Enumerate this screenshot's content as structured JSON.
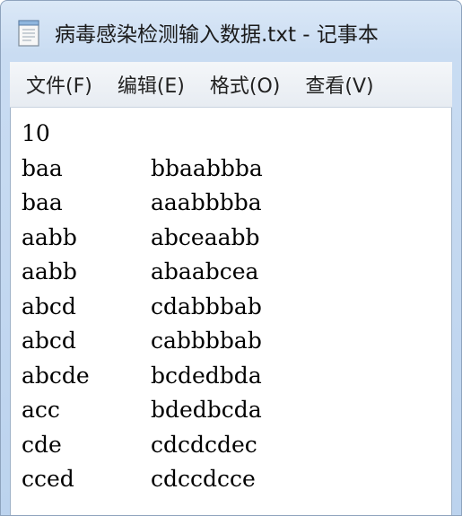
{
  "window": {
    "title": "病毒感染检测输入数据.txt - 记事本"
  },
  "menu": [
    "文件(F)",
    "编辑(E)",
    "格式(O)",
    "查看(V)"
  ],
  "document": {
    "first_line": "10",
    "rows": [
      [
        "baa",
        "bbaabbba"
      ],
      [
        "baa",
        "aaabbbba"
      ],
      [
        "aabb",
        "abceaabb"
      ],
      [
        "aabb",
        "abaabcea"
      ],
      [
        "abcd",
        "cdabbbab"
      ],
      [
        "abcd",
        "cabbbbab"
      ],
      [
        "abcde",
        "bcdedbda"
      ],
      [
        "acc",
        "bdedbcda"
      ],
      [
        "cde",
        "cdcdcdec"
      ],
      [
        "cced",
        "cdccdcce"
      ]
    ]
  }
}
